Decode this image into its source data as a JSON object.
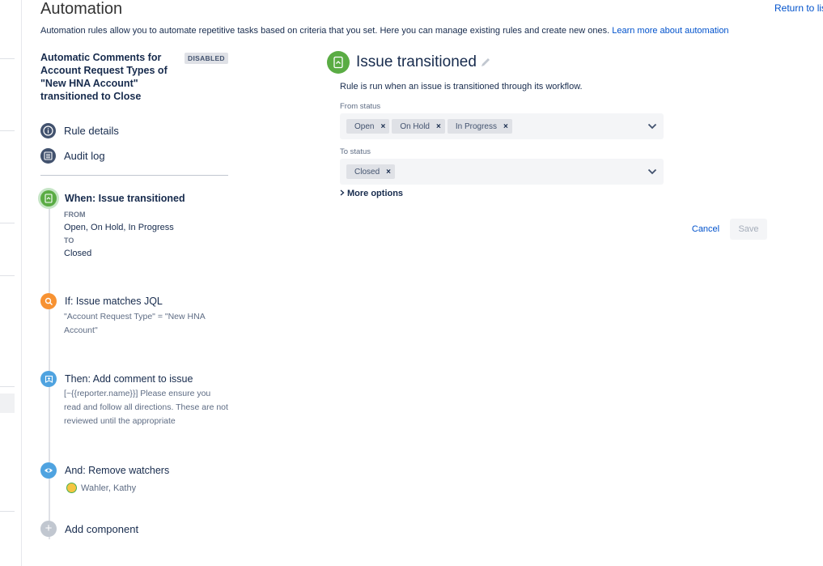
{
  "header": {
    "title": "Automation",
    "return_link": "Return to lis",
    "description": "Automation rules allow you to automate repetitive tasks based on criteria that you set. Here you can manage existing rules and create new ones.",
    "learn_more": "Learn more about automation"
  },
  "rule": {
    "name": "Automatic Comments for Account Request Types of \"New HNA Account\" transitioned to Close",
    "status_badge": "DISABLED"
  },
  "nav": {
    "rule_details": "Rule details",
    "audit_log": "Audit log"
  },
  "components": {
    "trigger": {
      "title": "When: Issue transitioned",
      "from_label": "FROM",
      "from_value": "Open, On Hold, In Progress",
      "to_label": "TO",
      "to_value": "Closed"
    },
    "condition": {
      "title": "If: Issue matches JQL",
      "description": "\"Account Request Type\" = \"New HNA Account\""
    },
    "action_comment": {
      "title": "Then: Add comment to issue",
      "description": "[~{{reporter.name}}] Please ensure you read and follow all directions. These are not reviewed until the appropriate"
    },
    "action_watchers": {
      "title": "And: Remove watchers",
      "watcher": "Wahler, Kathy"
    },
    "add_component": "Add component"
  },
  "panel": {
    "title": "Issue transitioned",
    "description": "Rule is run when an issue is transitioned through its workflow.",
    "from_status_label": "From status",
    "from_status_tags": [
      "Open",
      "On Hold",
      "In Progress"
    ],
    "to_status_label": "To status",
    "to_status_tags": [
      "Closed"
    ],
    "tag_remove": "×",
    "more_options": "More options",
    "cancel": "Cancel",
    "save": "Save"
  },
  "colors": {
    "trigger": "#5aac44",
    "condition": "#f79232",
    "action": "#4fa3e0",
    "nav_icon": "#42526e",
    "link": "#0052cc"
  },
  "icons": {
    "rule_details": "info-icon",
    "audit_log": "list-icon",
    "trigger": "transition-icon",
    "condition": "search-icon",
    "action_comment": "comment-icon",
    "action_watchers": "eye-icon",
    "add": "plus-icon",
    "edit": "pencil-icon"
  }
}
